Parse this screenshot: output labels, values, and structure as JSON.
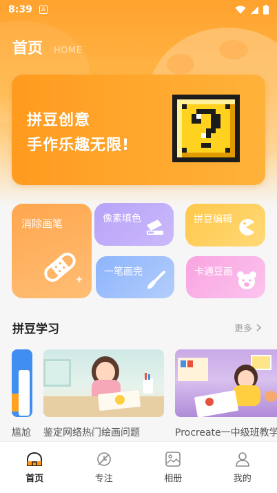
{
  "status": {
    "time": "8:39",
    "a_badge": "A"
  },
  "header": {
    "title": "首页",
    "subtitle": "HOME"
  },
  "banner": {
    "line1": "拼豆创意",
    "line2": "手作乐趣无限!"
  },
  "features": {
    "erase": "消除画笔",
    "pixel_fill": "像素填色",
    "bead_edit": "拼豆编辑",
    "one_stroke": "一笔画完",
    "cartoon_bead": "卡通豆画"
  },
  "learning": {
    "title": "拼豆学习",
    "more": "更多",
    "items": [
      {
        "caption": "尴尬"
      },
      {
        "caption": "鉴定网络热门绘画问题"
      },
      {
        "caption": "Procreate一中级班教学"
      }
    ]
  },
  "nav": [
    {
      "label": "首页",
      "icon": "home-icon"
    },
    {
      "label": "专注",
      "icon": "leaf-icon"
    },
    {
      "label": "相册",
      "icon": "album-icon"
    },
    {
      "label": "我的",
      "icon": "user-icon"
    }
  ],
  "colors": {
    "accent": "#ffa22e",
    "nav_active": "#ff9a1f"
  }
}
